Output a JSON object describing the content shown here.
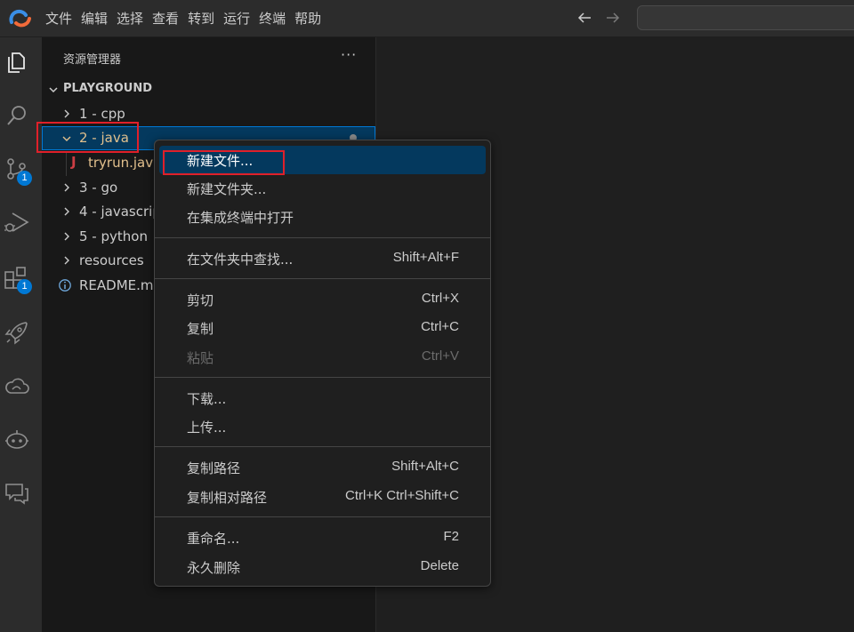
{
  "colors": {
    "accent": "#0078d4",
    "menu_active_bg": "#04395e",
    "highlight_red": "#e0202a",
    "java_icon": "#cc3e44",
    "modified_text": "#e2c08d"
  },
  "titlebar": {
    "logo_icon": "codespace-logo-icon",
    "menu": [
      "文件",
      "编辑",
      "选择",
      "查看",
      "转到",
      "运行",
      "终端",
      "帮助"
    ]
  },
  "activitybar": {
    "items": [
      {
        "icon": "files-icon"
      },
      {
        "icon": "search-icon"
      },
      {
        "icon": "source-control-icon",
        "badge": "1"
      },
      {
        "icon": "run-debug-icon"
      },
      {
        "icon": "extensions-icon",
        "badge": "1"
      },
      {
        "icon": "rocket-icon"
      },
      {
        "icon": "cloud-icon"
      },
      {
        "icon": "robot-icon"
      },
      {
        "icon": "feedback-icon"
      }
    ]
  },
  "explorer": {
    "title": "资源管理器",
    "more": "···",
    "section": "PLAYGROUND",
    "tree": [
      {
        "label": "1 - cpp",
        "type": "folder",
        "expanded": false
      },
      {
        "label": "2 - java",
        "type": "folder",
        "expanded": true,
        "selected": true
      },
      {
        "label": "tryrun.java",
        "type": "file",
        "icon_text": "J"
      },
      {
        "label": "3 - go",
        "type": "folder",
        "expanded": false
      },
      {
        "label": "4 - javascrip",
        "type": "folder",
        "expanded": false
      },
      {
        "label": "5 - python",
        "type": "folder",
        "expanded": false
      },
      {
        "label": "resources",
        "type": "folder",
        "expanded": false
      },
      {
        "label": "README.mc",
        "type": "info-file"
      }
    ]
  },
  "context_menu": {
    "groups": [
      [
        {
          "label": "新建文件...",
          "shortcut": "",
          "active": true
        },
        {
          "label": "新建文件夹...",
          "shortcut": ""
        },
        {
          "label": "在集成终端中打开",
          "shortcut": ""
        }
      ],
      [
        {
          "label": "在文件夹中查找...",
          "shortcut": "Shift+Alt+F"
        }
      ],
      [
        {
          "label": "剪切",
          "shortcut": "Ctrl+X"
        },
        {
          "label": "复制",
          "shortcut": "Ctrl+C"
        },
        {
          "label": "粘贴",
          "shortcut": "Ctrl+V",
          "disabled": true
        }
      ],
      [
        {
          "label": "下载...",
          "shortcut": ""
        },
        {
          "label": "上传...",
          "shortcut": ""
        }
      ],
      [
        {
          "label": "复制路径",
          "shortcut": "Shift+Alt+C"
        },
        {
          "label": "复制相对路径",
          "shortcut": "Ctrl+K Ctrl+Shift+C"
        }
      ],
      [
        {
          "label": "重命名...",
          "shortcut": "F2"
        },
        {
          "label": "永久删除",
          "shortcut": "Delete"
        }
      ]
    ]
  }
}
